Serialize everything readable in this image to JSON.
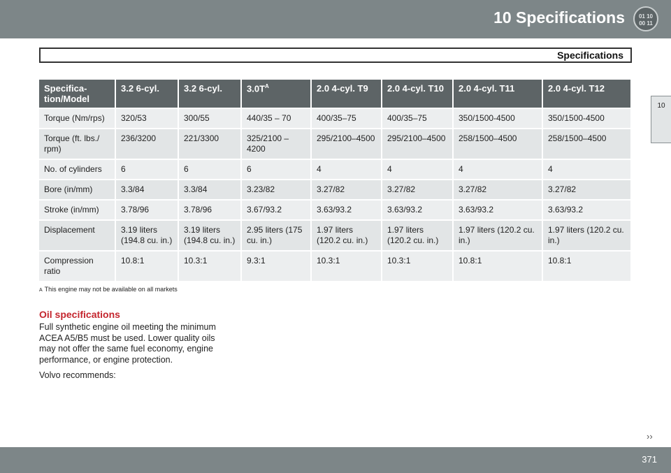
{
  "header": {
    "chapter_title": "10  Specifications",
    "icon_top": "01 10",
    "icon_bottom": "00 11"
  },
  "section": {
    "title": "Specifications"
  },
  "side_tab": {
    "label": "10"
  },
  "table": {
    "headers": [
      "Specifica-tion/Model",
      "3.2 6-cyl.",
      "3.2 6-cyl.",
      "3.0T",
      "2.0 4-cyl. T9",
      "2.0 4-cyl. T10",
      "2.0 4-cyl. T11",
      "2.0 4-cyl. T12"
    ],
    "header_sup": "A",
    "rows": [
      [
        "Torque (Nm/rps)",
        "320/53",
        "300/55",
        "440/35 – 70",
        "400/35–75",
        "400/35–75",
        "350/1500-4500",
        "350/1500-4500"
      ],
      [
        "Torque (ft. lbs./ rpm)",
        "236/3200",
        "221/3300",
        "325/2100 – 4200",
        "295/2100–4500",
        "295/2100–4500",
        "258/1500–4500",
        "258/1500–4500"
      ],
      [
        "No. of cylinders",
        "6",
        "6",
        "6",
        "4",
        "4",
        "4",
        "4"
      ],
      [
        "Bore (in/mm)",
        "3.3/84",
        "3.3/84",
        "3.23/82",
        "3.27/82",
        "3.27/82",
        "3.27/82",
        "3.27/82"
      ],
      [
        "Stroke (in/mm)",
        "3.78/96",
        "3.78/96",
        "3.67/93.2",
        "3.63/93.2",
        "3.63/93.2",
        "3.63/93.2",
        "3.63/93.2"
      ],
      [
        "Displacement",
        "3.19 liters (194.8 cu. in.)",
        "3.19 liters (194.8 cu. in.)",
        "2.95 liters (175 cu. in.)",
        "1.97 liters (120.2 cu. in.)",
        "1.97 liters (120.2 cu. in.)",
        "1.97 liters (120.2 cu. in.)",
        "1.97 liters (120.2 cu. in.)"
      ],
      [
        "Compression ratio",
        "10.8:1",
        "10.3:1",
        "9.3:1",
        "10.3:1",
        "10.3:1",
        "10.8:1",
        "10.8:1"
      ]
    ]
  },
  "footnote": {
    "marker": "A",
    "text": "This engine may not be available on all markets"
  },
  "oil": {
    "heading": "Oil specifications",
    "body": "Full synthetic engine oil meeting the minimum ACEA A5/B5 must be used. Lower quality oils may not offer the same fuel economy, engine performance, or engine protection.",
    "recommends": "Volvo recommends:"
  },
  "footer": {
    "next_arrows": "››",
    "page_number": "371"
  }
}
